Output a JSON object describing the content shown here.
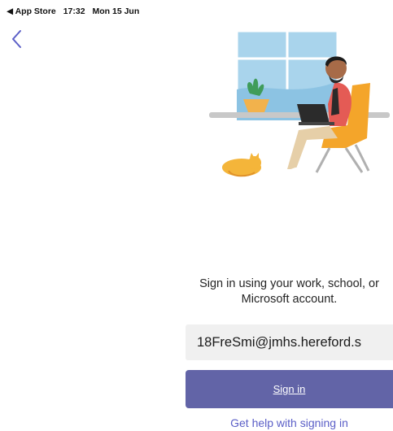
{
  "status_bar": {
    "back_app": "◀ App Store",
    "time": "17:32",
    "date": "Mon 15 Jun"
  },
  "nav": {
    "back_icon": "chevron-left-icon"
  },
  "illustration": {
    "name": "person-with-laptop-illustration"
  },
  "signin": {
    "prompt": "Sign in using your work, school, or Microsoft account.",
    "email_value": "18FreSmi@jmhs.hereford.s",
    "button_label": "Sign in",
    "help_link": "Get help with signing in"
  },
  "colors": {
    "accent": "#6264a7",
    "link": "#5b5fc7",
    "field_bg": "#f0f0f0"
  }
}
